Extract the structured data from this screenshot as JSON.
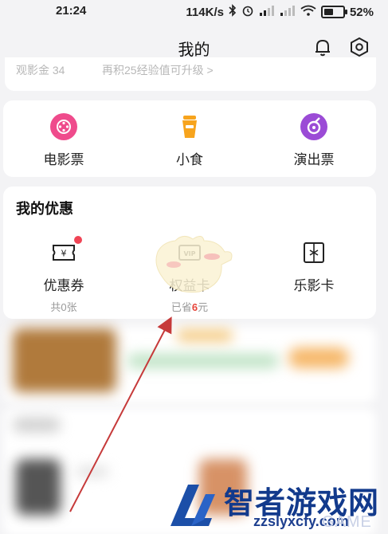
{
  "status_bar": {
    "time": "21:24",
    "speed": "114K/s",
    "battery_level": 0.52,
    "battery_text": "52%"
  },
  "header": {
    "title": "我的"
  },
  "top_card": {
    "left_text": "观影金 34",
    "right_text": "再积25经验值可升级 >"
  },
  "services": [
    {
      "label": "电影票",
      "icon": "movie-ticket-icon",
      "color": "#ef4b8c"
    },
    {
      "label": "小食",
      "icon": "snack-icon",
      "color": "#f7a41d"
    },
    {
      "label": "演出票",
      "icon": "show-ticket-icon",
      "color": "#9b4bd6"
    }
  ],
  "offers": {
    "title": "我的优惠",
    "items": [
      {
        "label": "优惠券",
        "sub": "共0张",
        "icon": "coupon-icon"
      },
      {
        "label": "权益卡",
        "sub_prefix": "已省",
        "sub_value": "6",
        "sub_suffix": "元",
        "icon": "vip-card-icon"
      },
      {
        "label": "乐影卡",
        "sub": "",
        "icon": "le-card-icon"
      }
    ]
  },
  "watermark": {
    "name": "智者游戏网",
    "url": "zzslyxcfy.com",
    "tag": "GAME"
  }
}
